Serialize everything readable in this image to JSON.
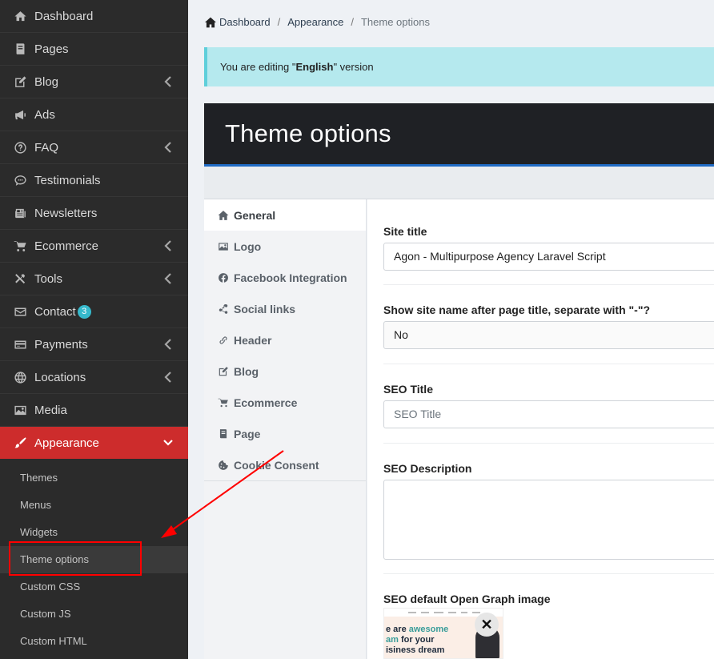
{
  "sidebar": {
    "items": [
      {
        "label": "Dashboard",
        "icon": "home-icon",
        "chevron": false
      },
      {
        "label": "Pages",
        "icon": "pages-icon",
        "chevron": false
      },
      {
        "label": "Blog",
        "icon": "edit-icon",
        "chevron": true
      },
      {
        "label": "Ads",
        "icon": "bullhorn-icon",
        "chevron": false
      },
      {
        "label": "FAQ",
        "icon": "question-icon",
        "chevron": true
      },
      {
        "label": "Testimonials",
        "icon": "comment-icon",
        "chevron": false
      },
      {
        "label": "Newsletters",
        "icon": "newspaper-icon",
        "chevron": false
      },
      {
        "label": "Ecommerce",
        "icon": "cart-icon",
        "chevron": true
      },
      {
        "label": "Tools",
        "icon": "tools-icon",
        "chevron": true
      },
      {
        "label": "Contact",
        "icon": "envelope-icon",
        "chevron": false,
        "badge": "3"
      },
      {
        "label": "Payments",
        "icon": "credit-card-icon",
        "chevron": true
      },
      {
        "label": "Locations",
        "icon": "globe-icon",
        "chevron": true
      },
      {
        "label": "Media",
        "icon": "image-icon",
        "chevron": false
      },
      {
        "label": "Appearance",
        "icon": "paintbrush-icon",
        "chevron": true,
        "active": true
      }
    ],
    "submenu": [
      "Themes",
      "Menus",
      "Widgets",
      "Theme options",
      "Custom CSS",
      "Custom JS",
      "Custom HTML"
    ]
  },
  "breadcrumb": {
    "home": "Dashboard",
    "parent": "Appearance",
    "current": "Theme options"
  },
  "alert": {
    "prefix": "You are editing \"",
    "lang": "English",
    "suffix": "\" version"
  },
  "panel": {
    "title": "Theme options"
  },
  "tabs": [
    "General",
    "Logo",
    "Facebook Integration",
    "Social links",
    "Header",
    "Blog",
    "Ecommerce",
    "Page",
    "Cookie Consent"
  ],
  "form": {
    "site_title": {
      "label": "Site title",
      "value": "Agon - Multipurpose Agency Laravel Script"
    },
    "show_site_name": {
      "label": "Show site name after page title, separate with \"-\"?",
      "value": "No"
    },
    "seo_title": {
      "label": "SEO Title",
      "placeholder": "SEO Title"
    },
    "seo_description": {
      "label": "SEO Description"
    },
    "og_image": {
      "label": "SEO default Open Graph image",
      "close": "✕"
    }
  },
  "og_preview": {
    "line1_plain": "e are ",
    "line1_accent": "awesome",
    "line2_accent": "am",
    "line2_plain": " for your",
    "line3": "isiness dream"
  },
  "colors": {
    "sidebar_bg": "#2b2b2b",
    "active": "#cd2c2c",
    "alert_bg": "#b5e9ee",
    "header_bg": "#1f2125",
    "accent_blue": "#206bc4",
    "annotation": "#ff0000"
  }
}
